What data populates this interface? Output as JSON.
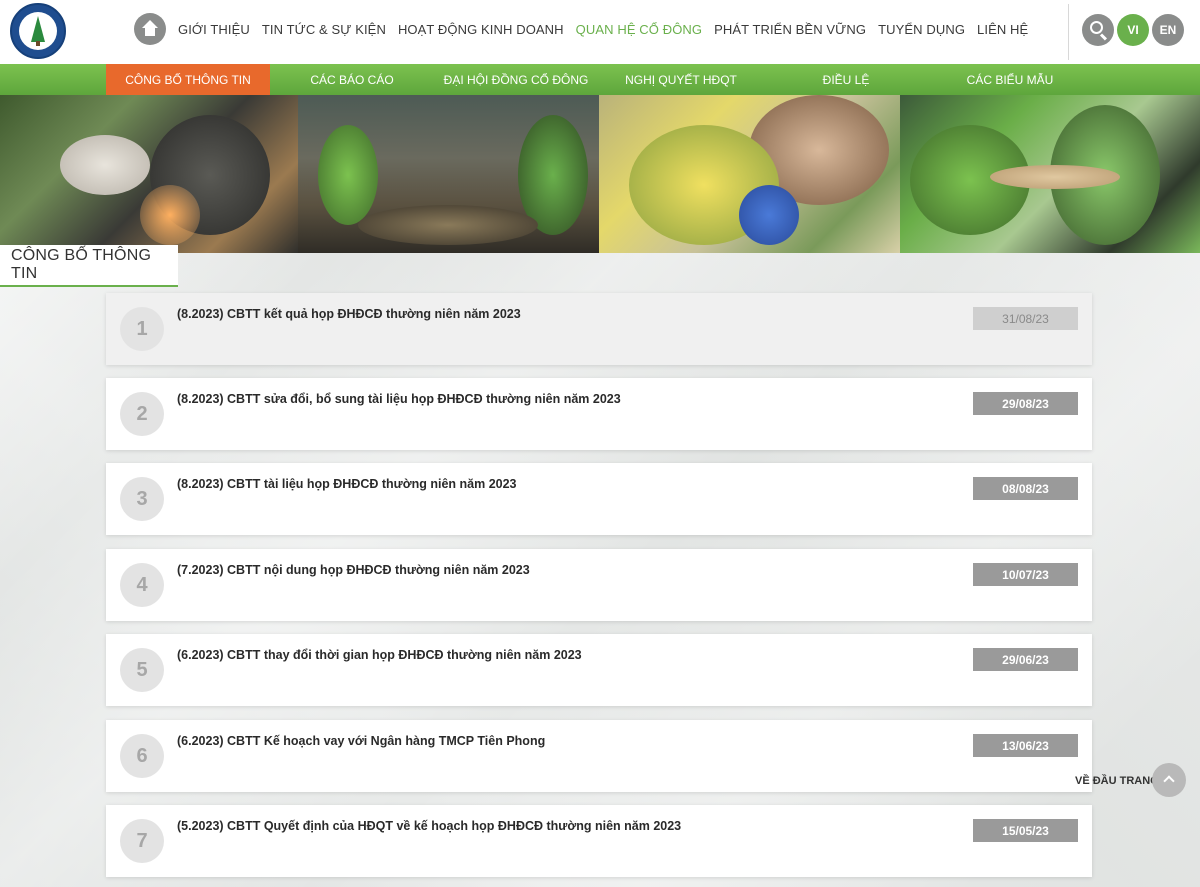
{
  "header": {
    "logo_name": "tree-logo",
    "nav": [
      {
        "label": "GIỚI THIỆU",
        "active": false
      },
      {
        "label": "TIN TỨC & SỰ KIỆN",
        "active": false
      },
      {
        "label": "HOẠT ĐỘNG KINH DOANH",
        "active": false
      },
      {
        "label": "QUAN HỆ CỔ ĐÔNG",
        "active": true
      },
      {
        "label": "PHÁT TRIỂN BỀN VỮNG",
        "active": false
      },
      {
        "label": "TUYỂN DỤNG",
        "active": false
      },
      {
        "label": "LIÊN HỆ",
        "active": false
      }
    ],
    "lang_vi": "VI",
    "lang_en": "EN"
  },
  "subnav": [
    {
      "label": "CÔNG BỐ THÔNG TIN",
      "active": true
    },
    {
      "label": "CÁC BÁO CÁO",
      "active": false
    },
    {
      "label": "ĐẠI HỘI ĐỒNG CỔ ĐÔNG",
      "active": false
    },
    {
      "label": "NGHỊ QUYẾT HĐQT",
      "active": false
    },
    {
      "label": "ĐIỀU LỆ",
      "active": false
    },
    {
      "label": "CÁC BIỂU MẪU",
      "active": false
    }
  ],
  "section_title": "CÔNG BỐ THÔNG TIN",
  "items": [
    {
      "num": "1",
      "title": "(8.2023) CBTT kết quả họp ĐHĐCĐ thường niên năm 2023",
      "date": "31/08/23"
    },
    {
      "num": "2",
      "title": "(8.2023) CBTT sửa đổi, bổ sung tài liệu họp ĐHĐCĐ thường niên năm 2023",
      "date": "29/08/23"
    },
    {
      "num": "3",
      "title": "(8.2023) CBTT tài liệu họp ĐHĐCĐ thường niên năm 2023",
      "date": "08/08/23"
    },
    {
      "num": "4",
      "title": "(7.2023) CBTT nội dung họp ĐHĐCĐ thường niên năm 2023",
      "date": "10/07/23"
    },
    {
      "num": "5",
      "title": "(6.2023) CBTT thay đổi thời gian họp ĐHĐCĐ thường niên năm 2023",
      "date": "29/06/23"
    },
    {
      "num": "6",
      "title": "(6.2023) CBTT Kế hoạch vay với Ngân hàng TMCP Tiên Phong",
      "date": "13/06/23"
    },
    {
      "num": "7",
      "title": "(5.2023) CBTT Quyết định của HĐQT về kế hoạch họp ĐHĐCĐ thường niên năm 2023",
      "date": "15/05/23"
    }
  ],
  "back_to_top": "VỀ ĐẦU TRANG",
  "colors": {
    "accent_green": "#6ab04c",
    "accent_orange": "#e8692c",
    "date_badge": "#9a9a9a"
  }
}
